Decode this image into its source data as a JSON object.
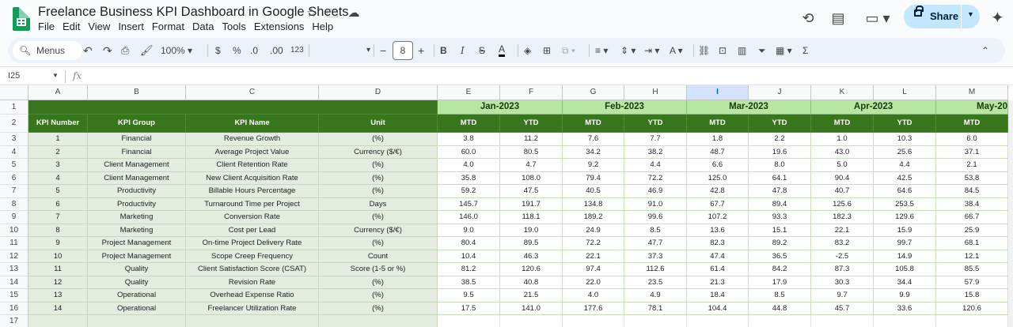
{
  "app": {
    "title": "Freelance Business KPI Dashboard in Google Sheets",
    "menu": [
      "File",
      "Edit",
      "View",
      "Insert",
      "Format",
      "Data",
      "Tools",
      "Extensions",
      "Help"
    ],
    "share_label": "Share",
    "icons": [
      "star-icon",
      "move-to-folder-icon",
      "cloud-status-icon",
      "history-icon",
      "comment-icon",
      "meet-icon",
      "lock-icon",
      "gemini-icon"
    ]
  },
  "toolbar": {
    "menus_label": "Menus",
    "zoom": "100%",
    "currency": "$",
    "percent": "%",
    "decrease_decimal": ".0",
    "increase_decimal": ".00",
    "number_format": "123",
    "font_size": "8"
  },
  "formula_bar": {
    "name_box": "I25",
    "fx": "fx"
  },
  "columns": [
    "A",
    "B",
    "C",
    "D",
    "E",
    "F",
    "G",
    "H",
    "I",
    "J",
    "K",
    "L",
    "M"
  ],
  "rows": [
    "1",
    "2",
    "3",
    "4",
    "5",
    "6",
    "7",
    "8",
    "9",
    "10",
    "11",
    "12",
    "13",
    "14",
    "15",
    "16",
    "17"
  ],
  "sheet": {
    "months": [
      "Jan-2023",
      "Feb-2023",
      "Mar-2023",
      "Apr-2023",
      "May-20"
    ],
    "headers": [
      "KPI Number",
      "KPI Group",
      "KPI Name",
      "Unit"
    ],
    "sub_headers": [
      "MTD",
      "YTD",
      "MTD",
      "YTD",
      "MTD",
      "YTD",
      "MTD",
      "YTD",
      "MTD"
    ],
    "kpis": [
      {
        "num": "1",
        "group": "Financial",
        "name": "Revenue Growth",
        "unit": "(%)",
        "vals": [
          "3.8",
          "11.2",
          "7.6",
          "7.7",
          "1.8",
          "2.2",
          "1.0",
          "10.3",
          "6.0"
        ]
      },
      {
        "num": "2",
        "group": "Financial",
        "name": "Average Project Value",
        "unit": "Currency ($/€)",
        "vals": [
          "60.0",
          "80.5",
          "34.2",
          "38.2",
          "48.7",
          "19.6",
          "43.0",
          "25.6",
          "37.1"
        ]
      },
      {
        "num": "3",
        "group": "Client Management",
        "name": "Client Retention Rate",
        "unit": "(%)",
        "vals": [
          "4.0",
          "4.7",
          "9.2",
          "4.4",
          "6.6",
          "8.0",
          "5.0",
          "4.4",
          "2.1"
        ]
      },
      {
        "num": "4",
        "group": "Client Management",
        "name": "New Client Acquisition Rate",
        "unit": "(%)",
        "vals": [
          "35.8",
          "108.0",
          "79.4",
          "72.2",
          "125.0",
          "64.1",
          "90.4",
          "42.5",
          "53.8"
        ]
      },
      {
        "num": "5",
        "group": "Productivity",
        "name": "Billable Hours Percentage",
        "unit": "(%)",
        "vals": [
          "59.2",
          "47.5",
          "40.5",
          "46.9",
          "42.8",
          "47.8",
          "40.7",
          "64.6",
          "84.5"
        ]
      },
      {
        "num": "6",
        "group": "Productivity",
        "name": "Turnaround Time per Project",
        "unit": "Days",
        "vals": [
          "145.7",
          "191.7",
          "134.8",
          "91.0",
          "67.7",
          "89.4",
          "125.6",
          "253.5",
          "38.4"
        ]
      },
      {
        "num": "7",
        "group": "Marketing",
        "name": "Conversion Rate",
        "unit": "(%)",
        "vals": [
          "146.0",
          "118.1",
          "189.2",
          "99.6",
          "107.2",
          "93.3",
          "182.3",
          "129.6",
          "66.7"
        ]
      },
      {
        "num": "8",
        "group": "Marketing",
        "name": "Cost per Lead",
        "unit": "Currency ($/€)",
        "vals": [
          "9.0",
          "19.0",
          "24.9",
          "8.5",
          "13.6",
          "15.1",
          "22.1",
          "15.9",
          "25.9"
        ]
      },
      {
        "num": "9",
        "group": "Project Management",
        "name": "On-time Project Delivery Rate",
        "unit": "(%)",
        "vals": [
          "80.4",
          "89.5",
          "72.2",
          "47.7",
          "82.3",
          "89.2",
          "83.2",
          "99.7",
          "68.1"
        ]
      },
      {
        "num": "10",
        "group": "Project Management",
        "name": "Scope Creep Frequency",
        "unit": "Count",
        "vals": [
          "10.4",
          "46.3",
          "22.1",
          "37.3",
          "47.4",
          "36.5",
          "-2.5",
          "14.9",
          "12.1"
        ]
      },
      {
        "num": "11",
        "group": "Quality",
        "name": "Client Satisfaction Score (CSAT)",
        "unit": "Score (1-5 or %)",
        "vals": [
          "81.2",
          "120.6",
          "97.4",
          "112.6",
          "61.4",
          "84.2",
          "87.3",
          "105.8",
          "85.5"
        ]
      },
      {
        "num": "12",
        "group": "Quality",
        "name": "Revision Rate",
        "unit": "(%)",
        "vals": [
          "38.5",
          "40.8",
          "22.0",
          "23.5",
          "21.3",
          "17.9",
          "30.3",
          "34.4",
          "57.9"
        ]
      },
      {
        "num": "13",
        "group": "Operational",
        "name": "Overhead Expense Ratio",
        "unit": "(%)",
        "vals": [
          "9.5",
          "21.5",
          "4.0",
          "4.9",
          "18.4",
          "8.5",
          "9.7",
          "9.9",
          "15.8"
        ]
      },
      {
        "num": "14",
        "group": "Operational",
        "name": "Freelancer Utilization Rate",
        "unit": "(%)",
        "vals": [
          "17.5",
          "141.0",
          "177.6",
          "78.1",
          "104.4",
          "44.8",
          "45.7",
          "33.6",
          "120.6"
        ]
      }
    ]
  }
}
